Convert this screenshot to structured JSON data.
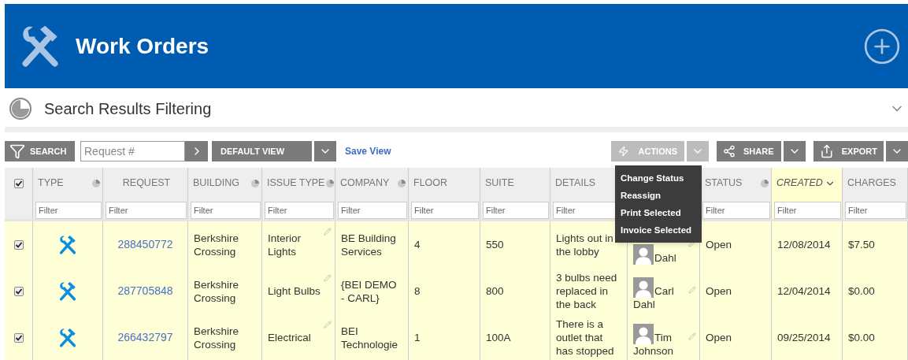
{
  "header": {
    "title": "Work Orders"
  },
  "filter_panel": {
    "title": "Search Results Filtering",
    "expanded": false
  },
  "toolbar": {
    "search_button": "SEARCH",
    "request_placeholder": "Request #",
    "view": "DEFAULT VIEW",
    "save_view": "Save View",
    "actions": "ACTIONS",
    "share": "SHARE",
    "export": "EXPORT"
  },
  "actions_menu": {
    "items": [
      "Change Status",
      "Reassign",
      "Print Selected",
      "Invoice Selected"
    ]
  },
  "table": {
    "all_checked": true,
    "columns": [
      {
        "kind": "icon",
        "label": "TYPE",
        "menu_icon": true,
        "sorted": false,
        "placeholder": "Filter"
      },
      {
        "kind": "link",
        "label": "REQUEST",
        "menu_icon": false,
        "sorted": false,
        "placeholder": "Filter"
      },
      {
        "kind": "text",
        "label": "BUILDING",
        "menu_icon": true,
        "sorted": false,
        "placeholder": "Filter"
      },
      {
        "kind": "editable",
        "label": "ISSUE TYPE",
        "menu_icon": true,
        "sorted": false,
        "placeholder": "Filter"
      },
      {
        "kind": "text",
        "label": "COMPANY",
        "menu_icon": true,
        "sorted": false,
        "placeholder": "Filter"
      },
      {
        "kind": "text",
        "label": "FLOOR",
        "menu_icon": false,
        "sorted": false,
        "placeholder": "Filter"
      },
      {
        "kind": "text",
        "label": "SUITE",
        "menu_icon": false,
        "sorted": false,
        "placeholder": "Filter"
      },
      {
        "kind": "text",
        "label": "DETAILS",
        "sorted": false,
        "placeholder": "Filter"
      },
      {
        "kind": "person"
      },
      {
        "kind": "text",
        "label": "STATUS",
        "menu_icon": true,
        "sorted": false,
        "placeholder": "Filter"
      },
      {
        "kind": "text",
        "label": "CREATED",
        "menu_icon": false,
        "sorted": true,
        "placeholder": "Filter"
      },
      {
        "kind": "text",
        "label": "CHARGES",
        "menu_icon": false,
        "sorted": false,
        "placeholder": "Filter"
      }
    ],
    "rows": [
      {
        "selected": true,
        "cells": [
          "",
          "288450772",
          "Berkshire Crossing",
          "Interior Lights",
          "BE Building Services",
          "4",
          "550",
          "Lights out in the lobby",
          "Dahl",
          "Open",
          "12/08/2014",
          "$7.50"
        ]
      },
      {
        "selected": true,
        "cells": [
          "",
          "287705848",
          "Berkshire Crossing",
          "Light Bulbs",
          "{BEI DEMO - CARL}",
          "8",
          "800",
          "3 bulbs need replaced in the back",
          "Carl Dahl",
          "Open",
          "12/04/2014",
          "$0.00"
        ]
      },
      {
        "selected": true,
        "cells": [
          "",
          "266432797",
          "Berkshire Crossing",
          "Electrical",
          "BEI Technologie",
          "1",
          "100A",
          "There is a outlet that has stopped",
          "Tim Johnson",
          "Open",
          "09/25/2014",
          "$0.00"
        ]
      }
    ]
  }
}
